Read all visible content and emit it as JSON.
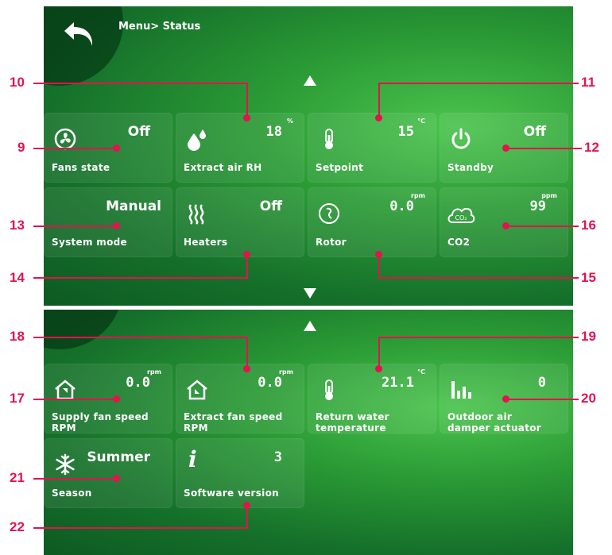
{
  "breadcrumb": "Menu> Status",
  "tiles": {
    "fans_state": {
      "value": "Off",
      "label": "Fans state"
    },
    "extract_air_rh": {
      "value": "18",
      "unit": "%",
      "label": "Extract air RH"
    },
    "setpoint": {
      "value": "15",
      "unit": "°C",
      "label": "Setpoint"
    },
    "standby": {
      "value": "Off",
      "label": "Standby"
    },
    "system_mode": {
      "value": "Manual",
      "label": "System mode"
    },
    "heaters": {
      "value": "Off",
      "label": "Heaters"
    },
    "rotor": {
      "value": "0.0",
      "unit": "rpm",
      "label": "Rotor"
    },
    "co2": {
      "value": "99",
      "unit": "ppm",
      "label": "CO2",
      "icon_text": "CO₂"
    },
    "supply_fan_speed": {
      "value": "0.0",
      "unit": "rpm",
      "label_line1": "Supply fan speed",
      "label_line2": "RPM"
    },
    "extract_fan_speed": {
      "value": "0.0",
      "unit": "rpm",
      "label_line1": "Extract fan speed",
      "label_line2": "RPM"
    },
    "return_water_temp": {
      "value": "21.1",
      "unit": "°C",
      "label_line1": "Return water",
      "label_line2": "temperature"
    },
    "outdoor_air_damper": {
      "value": "0",
      "label_line1": "Outdoor air",
      "label_line2": "damper actuator"
    },
    "season": {
      "value": "Summer",
      "label": "Season"
    },
    "software_version": {
      "value": "3",
      "label": "Software version",
      "icon_text": "i"
    }
  },
  "callouts": [
    "9",
    "10",
    "11",
    "12",
    "13",
    "14",
    "15",
    "16",
    "17",
    "18",
    "19",
    "20",
    "21",
    "22"
  ],
  "colors": {
    "callout": "#e3134e",
    "panel": "#2a9a35"
  }
}
